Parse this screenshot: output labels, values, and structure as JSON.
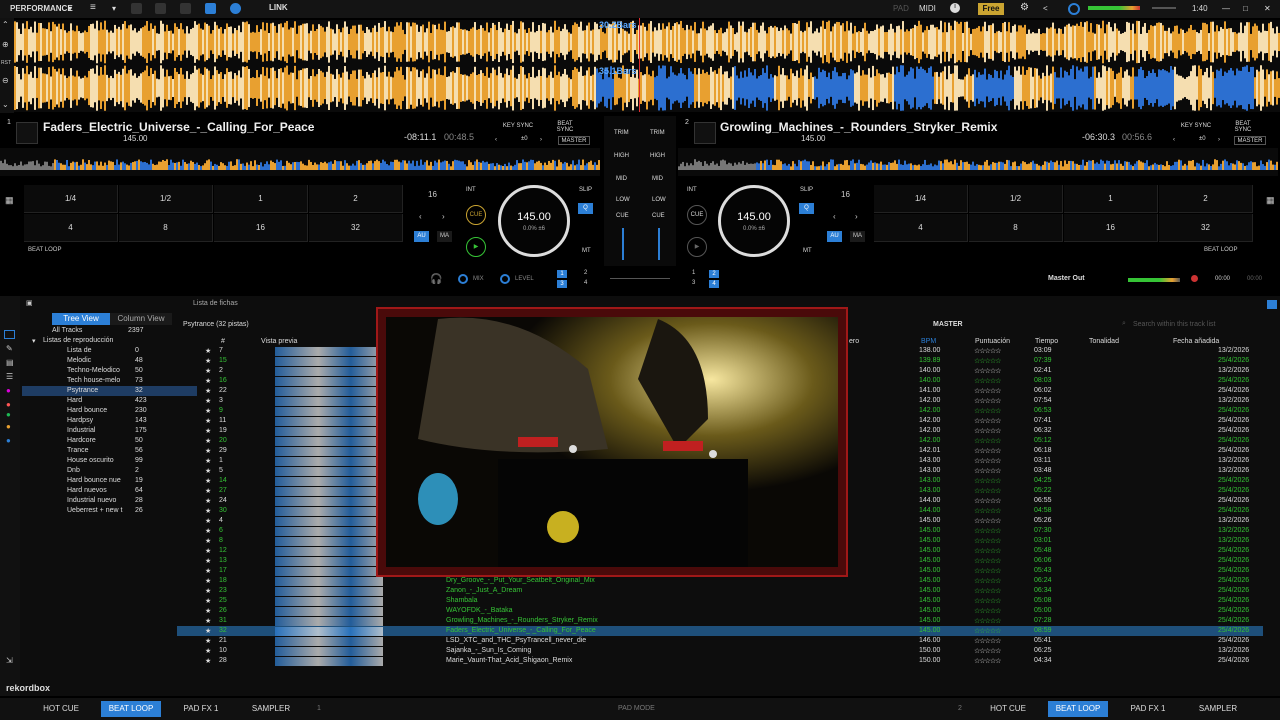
{
  "top": {
    "mode": "PERFORMANCE",
    "link": "LINK",
    "pad": "PAD",
    "midi": "MIDI",
    "free": "Free",
    "clock": "1:40"
  },
  "wave": {
    "bars_top": "30.2Bars",
    "bars_bottom": "35.1Bars",
    "rst": "RST"
  },
  "deck1": {
    "num": "1",
    "title": "Faders_Electric_Universe_-_Calling_For_Peace",
    "bpm": "145.00",
    "time_remain": "-08:11.1",
    "time_elapsed": "00:48.5",
    "key_sync": "KEY SYNC",
    "beat_sync": "BEAT SYNC",
    "pm": "±0",
    "master": "MASTER",
    "jog_bpm": "145.00",
    "jog_sub": "0.0% ±6",
    "beat_loop": "BEAT LOOP",
    "pads": [
      "1/4",
      "1/2",
      "1",
      "2",
      "4",
      "8",
      "16",
      "32"
    ],
    "loop_len": "16",
    "int": "INT",
    "cue": "CUE",
    "slip": "SLIP",
    "q": "Q",
    "au": "AU",
    "ma": "MA",
    "mt": "MT"
  },
  "deck2": {
    "num": "2",
    "title": "Growling_Machines_-_Rounders_Stryker_Remix",
    "bpm": "145.00",
    "time_remain": "-06:30.3",
    "time_elapsed": "00:56.6",
    "key_sync": "KEY SYNC",
    "beat_sync": "BEAT SYNC",
    "pm": "±0",
    "master": "MASTER",
    "jog_bpm": "145.00",
    "jog_sub": "0.0% ±6",
    "beat_loop": "BEAT LOOP",
    "pads": [
      "1/4",
      "1/2",
      "1",
      "2",
      "4",
      "8",
      "16",
      "32"
    ],
    "loop_len": "16",
    "int": "INT",
    "cue": "CUE",
    "slip": "SLIP",
    "q": "Q",
    "au": "AU",
    "ma": "MA",
    "mt": "MT"
  },
  "mixer": {
    "trim": "TRIM",
    "high": "HIGH",
    "mid": "MID",
    "low": "LOW",
    "cue": "CUE",
    "mix": "MIX",
    "level": "LEVEL",
    "master_out": "Master Out",
    "time1": "00:00",
    "time2": "00:00"
  },
  "browser": {
    "view_tree": "Tree View",
    "view_column": "Column View",
    "lista_fichas": "Lista de fichas",
    "all_tracks": "All Tracks",
    "all_count": "2397",
    "playlists_header": "Listas de reproducción",
    "playlists": [
      {
        "name": "Lista de",
        "count": "0"
      },
      {
        "name": "Melodic",
        "count": "48"
      },
      {
        "name": "Techno-Melodico",
        "count": "50"
      },
      {
        "name": "Tech house-melo",
        "count": "73"
      },
      {
        "name": "Psytrance",
        "count": "32"
      },
      {
        "name": "Hard",
        "count": "423"
      },
      {
        "name": "Hard bounce",
        "count": "230"
      },
      {
        "name": "Hardpsy",
        "count": "143"
      },
      {
        "name": "Industrial",
        "count": "175"
      },
      {
        "name": "Hardcore",
        "count": "50"
      },
      {
        "name": "Trance",
        "count": "56"
      },
      {
        "name": "House oscurito",
        "count": "99"
      },
      {
        "name": "Dnb",
        "count": "2"
      },
      {
        "name": "Hard bounce nue",
        "count": "19"
      },
      {
        "name": "Hard nuevos",
        "count": "64"
      },
      {
        "name": "Industrial nuevo",
        "count": "28"
      },
      {
        "name": "Ueberrest + new t",
        "count": "26"
      }
    ],
    "list_title": "Psytrance (32 pistas)",
    "master": "MASTER",
    "search": "Search within this track list",
    "cols": {
      "preview": "Vista previa",
      "num": "#",
      "genre": "ero",
      "bpm": "BPM",
      "rating": "Puntuación",
      "time": "Tiempo",
      "key": "Tonalidad",
      "added": "Fecha añadida"
    },
    "rows": [
      {
        "n": "7",
        "bpm": "138.00",
        "t": "03:09",
        "d": "13/2/2026",
        "g": false
      },
      {
        "n": "15",
        "bpm": "139.89",
        "t": "07:39",
        "d": "25/4/2026",
        "g": true
      },
      {
        "n": "2",
        "bpm": "140.00",
        "t": "02:41",
        "d": "13/2/2026",
        "g": false
      },
      {
        "n": "16",
        "bpm": "140.00",
        "t": "08:03",
        "d": "25/4/2026",
        "g": true
      },
      {
        "n": "22",
        "bpm": "141.00",
        "t": "06:02",
        "d": "25/4/2026",
        "g": false
      },
      {
        "n": "3",
        "bpm": "142.00",
        "t": "07:54",
        "d": "13/2/2026",
        "g": false
      },
      {
        "n": "9",
        "bpm": "142.00",
        "t": "06:53",
        "d": "25/4/2026",
        "g": true
      },
      {
        "n": "11",
        "bpm": "142.00",
        "t": "07:41",
        "d": "25/4/2026",
        "g": false
      },
      {
        "n": "19",
        "bpm": "142.00",
        "t": "06:32",
        "d": "25/4/2026",
        "g": false
      },
      {
        "n": "20",
        "bpm": "142.00",
        "t": "05:12",
        "d": "25/4/2026",
        "g": true
      },
      {
        "n": "29",
        "bpm": "142.01",
        "t": "06:18",
        "d": "25/4/2026",
        "g": false
      },
      {
        "n": "1",
        "bpm": "143.00",
        "t": "03:11",
        "d": "13/2/2026",
        "g": false
      },
      {
        "n": "5",
        "bpm": "143.00",
        "t": "03:48",
        "d": "13/2/2026",
        "g": false
      },
      {
        "n": "14",
        "bpm": "143.00",
        "t": "04:25",
        "d": "25/4/2026",
        "g": true
      },
      {
        "n": "27",
        "bpm": "143.00",
        "t": "05:22",
        "d": "25/4/2026",
        "g": true
      },
      {
        "n": "24",
        "bpm": "144.00",
        "t": "06:55",
        "d": "25/4/2026",
        "g": false
      },
      {
        "n": "30",
        "bpm": "144.00",
        "t": "04:58",
        "d": "25/4/2026",
        "g": true
      },
      {
        "n": "4",
        "bpm": "145.00",
        "t": "05:26",
        "d": "13/2/2026",
        "g": false
      },
      {
        "n": "6",
        "bpm": "145.00",
        "t": "07:30",
        "d": "13/2/2026",
        "g": true
      },
      {
        "n": "8",
        "bpm": "145.00",
        "t": "03:01",
        "d": "13/2/2026",
        "g": true
      },
      {
        "n": "12",
        "bpm": "145.00",
        "t": "05:48",
        "d": "25/4/2026",
        "g": true
      },
      {
        "n": "13",
        "bpm": "145.00",
        "t": "06:06",
        "d": "25/4/2026",
        "g": true
      },
      {
        "n": "17",
        "bpm": "145.00",
        "t": "05:43",
        "d": "25/4/2026",
        "g": true
      },
      {
        "n": "18",
        "bpm": "145.00",
        "t": "06:24",
        "d": "25/4/2026",
        "g": true,
        "title": "Dry_Groove_-_Put_Your_Seatbelt_Original_Mix"
      },
      {
        "n": "23",
        "bpm": "145.00",
        "t": "06:34",
        "d": "25/4/2026",
        "g": true,
        "title": "Zanon_-_Just_A_Dream"
      },
      {
        "n": "25",
        "bpm": "145.00",
        "t": "05:08",
        "d": "25/4/2026",
        "g": true,
        "title": "Shambala"
      },
      {
        "n": "26",
        "bpm": "145.00",
        "t": "05:00",
        "d": "25/4/2026",
        "g": true,
        "title": "WAYOFDK_-_Bataka"
      },
      {
        "n": "31",
        "bpm": "145.00",
        "t": "07:28",
        "d": "25/4/2026",
        "g": true,
        "title": "Growling_Machines_-_Rounders_Stryker_Remix"
      },
      {
        "n": "32",
        "bpm": "145.00",
        "t": "08:59",
        "d": "25/4/2026",
        "g": true,
        "title": "Faders_Electric_Universe_-_Calling_For_Peace",
        "sel": true
      },
      {
        "n": "21",
        "bpm": "146.00",
        "t": "05:41",
        "d": "25/4/2026",
        "g": false,
        "title": "LSD_XTC_and_THC_PsyTrancell_never_die"
      },
      {
        "n": "10",
        "bpm": "150.00",
        "t": "06:25",
        "d": "13/2/2026",
        "g": false,
        "title": "Sajanka_-_Sun_Is_Coming"
      },
      {
        "n": "28",
        "bpm": "150.00",
        "t": "04:34",
        "d": "25/4/2026",
        "g": false,
        "title": "Marie_Vaunt-That_Acid_Shigaon_Remix"
      }
    ]
  },
  "bottom": {
    "hot_cue": "HOT CUE",
    "beat_loop": "BEAT LOOP",
    "pad_fx": "PAD FX 1",
    "sampler": "SAMPLER",
    "deck1": "1",
    "pad_mode": "PAD MODE",
    "deck2": "2",
    "logo": "rekordbox"
  },
  "colors": {
    "accent": "#2c7fd6",
    "green": "#36c436",
    "orange": "#e8a030",
    "free": "#caa431"
  }
}
